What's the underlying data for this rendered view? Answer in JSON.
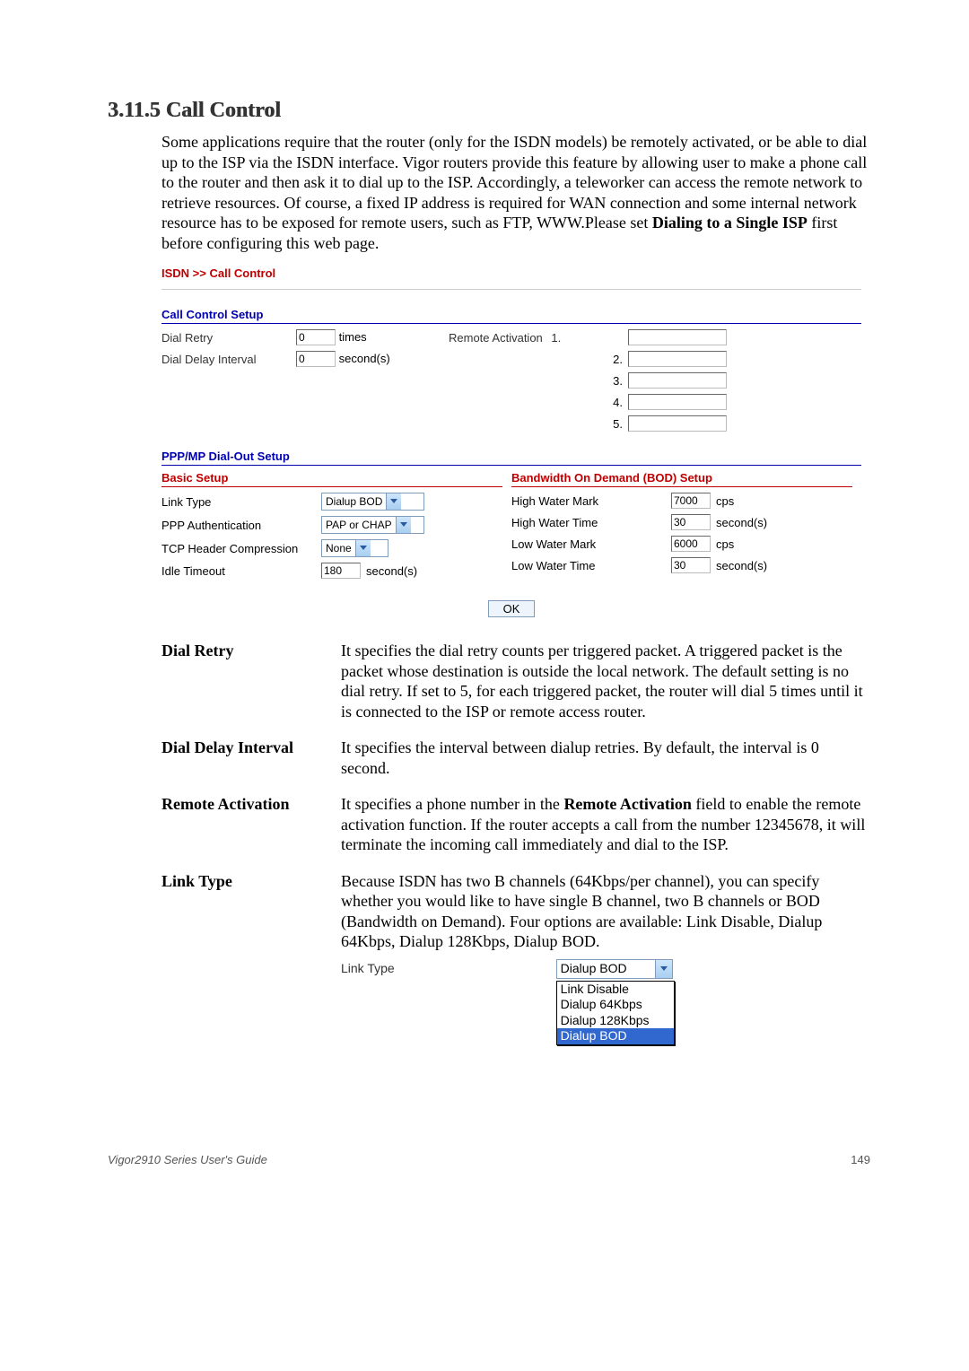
{
  "section_number": "3.11.5",
  "section_title": "Call Control",
  "intro_text_before": "Some applications require that the router (only for the ISDN models) be remotely activated, or be able to dial up to the ISP via the ISDN interface. Vigor routers provide this feature by allowing user to make a phone call to the router and then ask it to dial up to the ISP. Accordingly, a teleworker can access the remote network to retrieve resources. Of course, a fixed IP address is required for WAN connection and some internal network resource has to be exposed for remote users, such as FTP, WWW.Please set ",
  "intro_bold": "Dialing to a Single ISP",
  "intro_text_after": " first before configuring this web page.",
  "breadcrumb": "ISDN >> Call Control",
  "call_control_setup": {
    "title": "Call Control Setup",
    "dial_retry_label": "Dial Retry",
    "dial_retry_value": "0",
    "dial_retry_unit": "times",
    "dial_delay_label": "Dial Delay Interval",
    "dial_delay_value": "0",
    "dial_delay_unit": "second(s)",
    "remote_activation_label": "Remote Activation",
    "remote_numbers": [
      "1.",
      "2.",
      "3.",
      "4.",
      "5."
    ],
    "remote_values": [
      "",
      "",
      "",
      "",
      ""
    ]
  },
  "ppp_setup_title": "PPP/MP Dial-Out Setup",
  "basic_setup": {
    "title": "Basic Setup",
    "link_type_label": "Link Type",
    "link_type_value": "Dialup BOD",
    "ppp_auth_label": "PPP Authentication",
    "ppp_auth_value": "PAP or CHAP",
    "tcp_header_label": "TCP Header Compression",
    "tcp_header_value": "None",
    "idle_timeout_label": "Idle Timeout",
    "idle_timeout_value": "180",
    "idle_timeout_unit": "second(s)"
  },
  "bod_setup": {
    "title": "Bandwidth On Demand (BOD) Setup",
    "high_water_mark_label": "High Water Mark",
    "high_water_mark_value": "7000",
    "high_water_mark_unit": "cps",
    "high_water_time_label": "High Water Time",
    "high_water_time_value": "30",
    "high_water_time_unit": "second(s)",
    "low_water_mark_label": "Low Water Mark",
    "low_water_mark_value": "6000",
    "low_water_mark_unit": "cps",
    "low_water_time_label": "Low Water Time",
    "low_water_time_value": "30",
    "low_water_time_unit": "second(s)"
  },
  "ok_label": "OK",
  "definitions": {
    "dial_retry": {
      "term": "Dial Retry",
      "desc": "It specifies the dial retry counts per triggered packet. A triggered packet is the packet whose destination is outside the local network. The default setting is no dial retry. If set to 5, for each triggered packet, the router will dial 5 times until it is connected to the ISP or remote access router."
    },
    "dial_delay": {
      "term": "Dial Delay Interval",
      "desc": "It specifies the interval between dialup retries. By default, the interval is 0 second."
    },
    "remote_activation": {
      "term": "Remote Activation",
      "desc_before": "It specifies a phone number in the ",
      "desc_bold": "Remote Activation",
      "desc_after": " field to enable the remote activation function. If the router accepts a call from the number 12345678, it will terminate the incoming call immediately and dial to the ISP."
    },
    "link_type": {
      "term": "Link Type",
      "desc": "Because ISDN has two B channels (64Kbps/per channel), you can specify whether you would like to have single B channel, two B channels or BOD (Bandwidth on Demand). Four options are available: Link Disable, Dialup 64Kbps, Dialup 128Kbps, Dialup BOD."
    }
  },
  "link_type_dropdown": {
    "label": "Link Type",
    "selected": "Dialup BOD",
    "options": [
      "Link Disable",
      "Dialup 64Kbps",
      "Dialup 128Kbps",
      "Dialup BOD"
    ]
  },
  "footer_left": "Vigor2910 Series User's Guide",
  "footer_right": "149"
}
